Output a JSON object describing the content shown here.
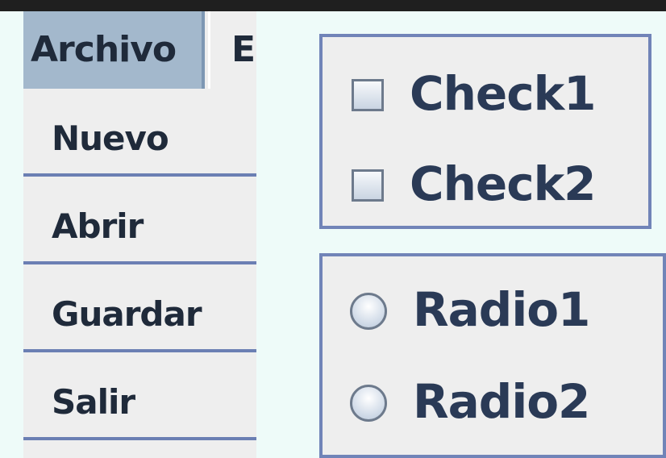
{
  "menubar": {
    "items": [
      {
        "label": "Archivo",
        "selected": true
      },
      {
        "label": "E",
        "selected": false
      }
    ]
  },
  "dropdown": {
    "items": [
      {
        "label": "Nuevo"
      },
      {
        "label": "Abrir"
      },
      {
        "label": "Guardar"
      },
      {
        "label": "Salir"
      }
    ]
  },
  "checkboxes": [
    {
      "label": "Check1",
      "checked": false
    },
    {
      "label": "Check2",
      "checked": false
    }
  ],
  "radios": [
    {
      "label": "Radio1",
      "selected": false
    },
    {
      "label": "Radio2",
      "selected": false
    }
  ],
  "colors": {
    "background": "#eefbf9",
    "menu_selected": "#a3b8cc",
    "panel_border": "#7184b8",
    "separator": "#6b7fb3"
  }
}
